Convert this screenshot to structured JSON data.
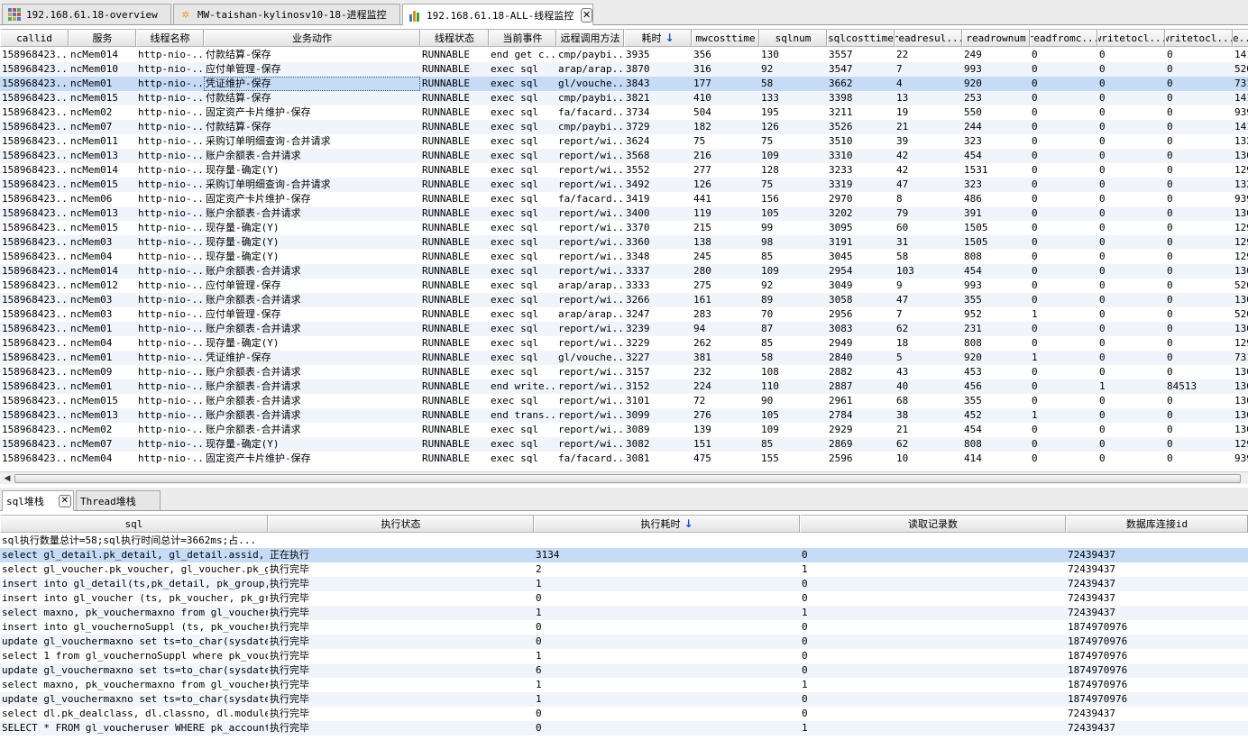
{
  "tabs": [
    {
      "label": "192.168.61.18-overview",
      "icon": "grid-icon",
      "active": false
    },
    {
      "label": "MW-taishan-kylinosv10-18-进程监控",
      "icon": "gear-icon",
      "active": false
    },
    {
      "label": "192.168.61.18-ALL-线程监控",
      "icon": "bar-chart-icon",
      "active": true,
      "close": "✕"
    }
  ],
  "thread_table": {
    "sort_arrow": "↓",
    "headers": [
      "callid",
      "服务",
      "线程名称",
      "业务动作",
      "线程状态",
      "当前事件",
      "远程调用方法",
      "耗时",
      "mwcosttime",
      "sqlnum",
      "sqlcosttime",
      "readresul...",
      "readrownum",
      "readfromc...",
      "writetocl...",
      "writetocl...",
      "re..."
    ],
    "rows": [
      [
        "158968423...",
        "ncMem014",
        "http-nio-...",
        "付款结算-保存",
        "RUNNABLE",
        "end get c...",
        "cmp/paybi...",
        "3935",
        "356",
        "130",
        "3557",
        "22",
        "249",
        "0",
        "0",
        "0",
        "141"
      ],
      [
        "158968423...",
        "ncMem010",
        "http-nio-...",
        "应付单管理-保存",
        "RUNNABLE",
        "exec sql",
        "arap/arap...",
        "3870",
        "316",
        "92",
        "3547",
        "7",
        "993",
        "0",
        "0",
        "0",
        "520"
      ],
      [
        "158968423...",
        "ncMem01",
        "http-nio-...",
        "凭证维护-保存",
        "RUNNABLE",
        "exec sql",
        "gl/vouche...",
        "3843",
        "177",
        "58",
        "3662",
        "4",
        "920",
        "0",
        "0",
        "0",
        "731"
      ],
      [
        "158968423...",
        "ncMem015",
        "http-nio-...",
        "付款结算-保存",
        "RUNNABLE",
        "exec sql",
        "cmp/paybi...",
        "3821",
        "410",
        "133",
        "3398",
        "13",
        "253",
        "0",
        "0",
        "0",
        "141"
      ],
      [
        "158968423...",
        "ncMem02",
        "http-nio-...",
        "固定资产卡片维护-保存",
        "RUNNABLE",
        "exec sql",
        "fa/facard...",
        "3734",
        "504",
        "195",
        "3211",
        "19",
        "550",
        "0",
        "0",
        "0",
        "939"
      ],
      [
        "158968423...",
        "ncMem07",
        "http-nio-...",
        "付款结算-保存",
        "RUNNABLE",
        "exec sql",
        "cmp/paybi...",
        "3729",
        "182",
        "126",
        "3526",
        "21",
        "244",
        "0",
        "0",
        "0",
        "141"
      ],
      [
        "158968423...",
        "ncMem011",
        "http-nio-...",
        "采购订单明细查询-合并请求",
        "RUNNABLE",
        "exec sql",
        "report/wi...",
        "3624",
        "75",
        "75",
        "3510",
        "39",
        "323",
        "0",
        "0",
        "0",
        "132"
      ],
      [
        "158968423...",
        "ncMem013",
        "http-nio-...",
        "账户余额表-合并请求",
        "RUNNABLE",
        "exec sql",
        "report/wi...",
        "3568",
        "216",
        "109",
        "3310",
        "42",
        "454",
        "0",
        "0",
        "0",
        "130"
      ],
      [
        "158968423...",
        "ncMem014",
        "http-nio-...",
        "现存量-确定(Y)",
        "RUNNABLE",
        "exec sql",
        "report/wi...",
        "3552",
        "277",
        "128",
        "3233",
        "42",
        "1531",
        "0",
        "0",
        "0",
        "129"
      ],
      [
        "158968423...",
        "ncMem015",
        "http-nio-...",
        "采购订单明细查询-合并请求",
        "RUNNABLE",
        "exec sql",
        "report/wi...",
        "3492",
        "126",
        "75",
        "3319",
        "47",
        "323",
        "0",
        "0",
        "0",
        "132"
      ],
      [
        "158968423...",
        "ncMem06",
        "http-nio-...",
        "固定资产卡片维护-保存",
        "RUNNABLE",
        "exec sql",
        "fa/facard...",
        "3419",
        "441",
        "156",
        "2970",
        "8",
        "486",
        "0",
        "0",
        "0",
        "939"
      ],
      [
        "158968423...",
        "ncMem013",
        "http-nio-...",
        "账户余额表-合并请求",
        "RUNNABLE",
        "exec sql",
        "report/wi...",
        "3400",
        "119",
        "105",
        "3202",
        "79",
        "391",
        "0",
        "0",
        "0",
        "130"
      ],
      [
        "158968423...",
        "ncMem015",
        "http-nio-...",
        "现存量-确定(Y)",
        "RUNNABLE",
        "exec sql",
        "report/wi...",
        "3370",
        "215",
        "99",
        "3095",
        "60",
        "1505",
        "0",
        "0",
        "0",
        "129"
      ],
      [
        "158968423...",
        "ncMem03",
        "http-nio-...",
        "现存量-确定(Y)",
        "RUNNABLE",
        "exec sql",
        "report/wi...",
        "3360",
        "138",
        "98",
        "3191",
        "31",
        "1505",
        "0",
        "0",
        "0",
        "129"
      ],
      [
        "158968423...",
        "ncMem04",
        "http-nio-...",
        "现存量-确定(Y)",
        "RUNNABLE",
        "exec sql",
        "report/wi...",
        "3348",
        "245",
        "85",
        "3045",
        "58",
        "808",
        "0",
        "0",
        "0",
        "129"
      ],
      [
        "158968423...",
        "ncMem014",
        "http-nio-...",
        "账户余额表-合并请求",
        "RUNNABLE",
        "exec sql",
        "report/wi...",
        "3337",
        "280",
        "109",
        "2954",
        "103",
        "454",
        "0",
        "0",
        "0",
        "130"
      ],
      [
        "158968423...",
        "ncMem012",
        "http-nio-...",
        "应付单管理-保存",
        "RUNNABLE",
        "exec sql",
        "arap/arap...",
        "3333",
        "275",
        "92",
        "3049",
        "9",
        "993",
        "0",
        "0",
        "0",
        "520"
      ],
      [
        "158968423...",
        "ncMem03",
        "http-nio-...",
        "账户余额表-合并请求",
        "RUNNABLE",
        "exec sql",
        "report/wi...",
        "3266",
        "161",
        "89",
        "3058",
        "47",
        "355",
        "0",
        "0",
        "0",
        "130"
      ],
      [
        "158968423...",
        "ncMem03",
        "http-nio-...",
        "应付单管理-保存",
        "RUNNABLE",
        "exec sql",
        "arap/arap...",
        "3247",
        "283",
        "70",
        "2956",
        "7",
        "952",
        "1",
        "0",
        "0",
        "520"
      ],
      [
        "158968423...",
        "ncMem01",
        "http-nio-...",
        "账户余额表-合并请求",
        "RUNNABLE",
        "exec sql",
        "report/wi...",
        "3239",
        "94",
        "87",
        "3083",
        "62",
        "231",
        "0",
        "0",
        "0",
        "130"
      ],
      [
        "158968423...",
        "ncMem04",
        "http-nio-...",
        "现存量-确定(Y)",
        "RUNNABLE",
        "exec sql",
        "report/wi...",
        "3229",
        "262",
        "85",
        "2949",
        "18",
        "808",
        "0",
        "0",
        "0",
        "129"
      ],
      [
        "158968423...",
        "ncMem01",
        "http-nio-...",
        "凭证维护-保存",
        "RUNNABLE",
        "exec sql",
        "gl/vouche...",
        "3227",
        "381",
        "58",
        "2840",
        "5",
        "920",
        "1",
        "0",
        "0",
        "731"
      ],
      [
        "158968423...",
        "ncMem09",
        "http-nio-...",
        "账户余额表-合并请求",
        "RUNNABLE",
        "exec sql",
        "report/wi...",
        "3157",
        "232",
        "108",
        "2882",
        "43",
        "453",
        "0",
        "0",
        "0",
        "130"
      ],
      [
        "158968423...",
        "ncMem01",
        "http-nio-...",
        "账户余额表-合并请求",
        "RUNNABLE",
        "end write...",
        "report/wi...",
        "3152",
        "224",
        "110",
        "2887",
        "40",
        "456",
        "0",
        "1",
        "84513",
        "130"
      ],
      [
        "158968423...",
        "ncMem015",
        "http-nio-...",
        "账户余额表-合并请求",
        "RUNNABLE",
        "exec sql",
        "report/wi...",
        "3101",
        "72",
        "90",
        "2961",
        "68",
        "355",
        "0",
        "0",
        "0",
        "130"
      ],
      [
        "158968423...",
        "ncMem013",
        "http-nio-...",
        "账户余额表-合并请求",
        "RUNNABLE",
        "end trans...",
        "report/wi...",
        "3099",
        "276",
        "105",
        "2784",
        "38",
        "452",
        "1",
        "0",
        "0",
        "130"
      ],
      [
        "158968423...",
        "ncMem02",
        "http-nio-...",
        "账户余额表-合并请求",
        "RUNNABLE",
        "exec sql",
        "report/wi...",
        "3089",
        "139",
        "109",
        "2929",
        "21",
        "454",
        "0",
        "0",
        "0",
        "130"
      ],
      [
        "158968423...",
        "ncMem07",
        "http-nio-...",
        "现存量-确定(Y)",
        "RUNNABLE",
        "exec sql",
        "report/wi...",
        "3082",
        "151",
        "85",
        "2869",
        "62",
        "808",
        "0",
        "0",
        "0",
        "129"
      ],
      [
        "158968423...",
        "ncMem04",
        "http-nio-...",
        "固定资产卡片维护-保存",
        "RUNNABLE",
        "exec sql",
        "fa/facard...",
        "3081",
        "475",
        "155",
        "2596",
        "10",
        "414",
        "0",
        "0",
        "0",
        "939"
      ]
    ],
    "selected_row": 2
  },
  "bottom_tabs": [
    {
      "label": "sql堆栈",
      "active": true,
      "close": "✕"
    },
    {
      "label": "Thread堆栈",
      "active": false
    }
  ],
  "sql_table": {
    "sort_arrow": "↓",
    "headers": [
      "sql",
      "执行状态",
      "执行耗时",
      "读取记录数",
      "数据库连接id"
    ],
    "summary": "sql执行数量总计=58;sql执行时间总计=3662ms;占...",
    "rows": [
      [
        "select gl_detail.pk_detail, gl_detail.assid, ...",
        "正在执行",
        "3134",
        "0",
        "72439437"
      ],
      [
        "select gl_voucher.pk_voucher, gl_voucher.pk_g...",
        "执行完毕",
        "2",
        "1",
        "72439437"
      ],
      [
        "insert into gl_detail(ts,pk_detail, pk_group,...",
        "执行完毕",
        "1",
        "0",
        "72439437"
      ],
      [
        "insert into gl_voucher (ts, pk_voucher, pk_gr...",
        "执行完毕",
        "0",
        "0",
        "72439437"
      ],
      [
        "select maxno, pk_vouchermaxno from gl_voucher...",
        "执行完毕",
        "1",
        "1",
        "72439437"
      ],
      [
        "insert into gl_vouchernoSuppl (ts, pk_voucher...",
        "执行完毕",
        "0",
        "0",
        "1874970976"
      ],
      [
        "update gl_vouchermaxno set ts=to_char(sysdate...",
        "执行完毕",
        "0",
        "0",
        "1874970976"
      ],
      [
        "select 1 from gl_vouchernoSuppl where pk_vouc...",
        "执行完毕",
        "1",
        "0",
        "1874970976"
      ],
      [
        "update gl_vouchermaxno set ts=to_char(sysdate...",
        "执行完毕",
        "6",
        "0",
        "1874970976"
      ],
      [
        "select maxno, pk_vouchermaxno from gl_voucher...",
        "执行完毕",
        "1",
        "1",
        "1874970976"
      ],
      [
        "update gl_vouchermaxno set ts=to_char(sysdate...",
        "执行完毕",
        "1",
        "0",
        "1874970976"
      ],
      [
        "select dl.pk_dealclass, dl.classno, dl.module...",
        "执行完毕",
        "0",
        "0",
        "72439437"
      ],
      [
        "SELECT * FROM gl_voucheruser WHERE pk_account...",
        "执行完毕",
        "0",
        "1",
        "72439437"
      ]
    ],
    "selected_row": 0
  },
  "colors": {
    "selected_row": "#c6dcf6",
    "alt_row": "#f0f5fc",
    "sort_arrow": "#1a50d0"
  }
}
